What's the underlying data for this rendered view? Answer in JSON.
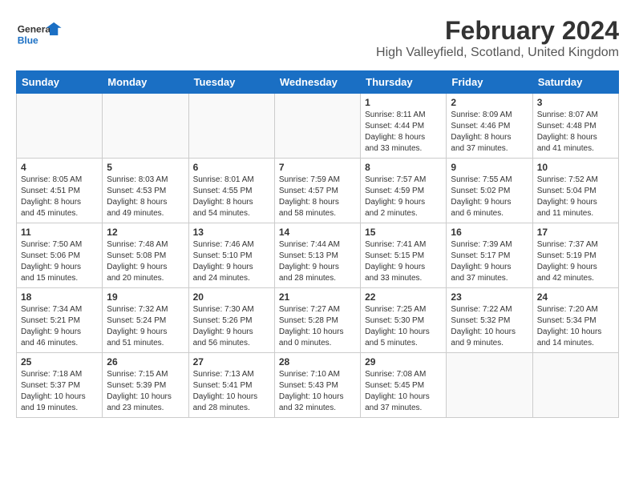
{
  "logo": {
    "line1": "General",
    "line2": "Blue"
  },
  "title": "February 2024",
  "subtitle": "High Valleyfield, Scotland, United Kingdom",
  "days_of_week": [
    "Sunday",
    "Monday",
    "Tuesday",
    "Wednesday",
    "Thursday",
    "Friday",
    "Saturday"
  ],
  "weeks": [
    [
      {
        "day": "",
        "info": ""
      },
      {
        "day": "",
        "info": ""
      },
      {
        "day": "",
        "info": ""
      },
      {
        "day": "",
        "info": ""
      },
      {
        "day": "1",
        "info": "Sunrise: 8:11 AM\nSunset: 4:44 PM\nDaylight: 8 hours\nand 33 minutes."
      },
      {
        "day": "2",
        "info": "Sunrise: 8:09 AM\nSunset: 4:46 PM\nDaylight: 8 hours\nand 37 minutes."
      },
      {
        "day": "3",
        "info": "Sunrise: 8:07 AM\nSunset: 4:48 PM\nDaylight: 8 hours\nand 41 minutes."
      }
    ],
    [
      {
        "day": "4",
        "info": "Sunrise: 8:05 AM\nSunset: 4:51 PM\nDaylight: 8 hours\nand 45 minutes."
      },
      {
        "day": "5",
        "info": "Sunrise: 8:03 AM\nSunset: 4:53 PM\nDaylight: 8 hours\nand 49 minutes."
      },
      {
        "day": "6",
        "info": "Sunrise: 8:01 AM\nSunset: 4:55 PM\nDaylight: 8 hours\nand 54 minutes."
      },
      {
        "day": "7",
        "info": "Sunrise: 7:59 AM\nSunset: 4:57 PM\nDaylight: 8 hours\nand 58 minutes."
      },
      {
        "day": "8",
        "info": "Sunrise: 7:57 AM\nSunset: 4:59 PM\nDaylight: 9 hours\nand 2 minutes."
      },
      {
        "day": "9",
        "info": "Sunrise: 7:55 AM\nSunset: 5:02 PM\nDaylight: 9 hours\nand 6 minutes."
      },
      {
        "day": "10",
        "info": "Sunrise: 7:52 AM\nSunset: 5:04 PM\nDaylight: 9 hours\nand 11 minutes."
      }
    ],
    [
      {
        "day": "11",
        "info": "Sunrise: 7:50 AM\nSunset: 5:06 PM\nDaylight: 9 hours\nand 15 minutes."
      },
      {
        "day": "12",
        "info": "Sunrise: 7:48 AM\nSunset: 5:08 PM\nDaylight: 9 hours\nand 20 minutes."
      },
      {
        "day": "13",
        "info": "Sunrise: 7:46 AM\nSunset: 5:10 PM\nDaylight: 9 hours\nand 24 minutes."
      },
      {
        "day": "14",
        "info": "Sunrise: 7:44 AM\nSunset: 5:13 PM\nDaylight: 9 hours\nand 28 minutes."
      },
      {
        "day": "15",
        "info": "Sunrise: 7:41 AM\nSunset: 5:15 PM\nDaylight: 9 hours\nand 33 minutes."
      },
      {
        "day": "16",
        "info": "Sunrise: 7:39 AM\nSunset: 5:17 PM\nDaylight: 9 hours\nand 37 minutes."
      },
      {
        "day": "17",
        "info": "Sunrise: 7:37 AM\nSunset: 5:19 PM\nDaylight: 9 hours\nand 42 minutes."
      }
    ],
    [
      {
        "day": "18",
        "info": "Sunrise: 7:34 AM\nSunset: 5:21 PM\nDaylight: 9 hours\nand 46 minutes."
      },
      {
        "day": "19",
        "info": "Sunrise: 7:32 AM\nSunset: 5:24 PM\nDaylight: 9 hours\nand 51 minutes."
      },
      {
        "day": "20",
        "info": "Sunrise: 7:30 AM\nSunset: 5:26 PM\nDaylight: 9 hours\nand 56 minutes."
      },
      {
        "day": "21",
        "info": "Sunrise: 7:27 AM\nSunset: 5:28 PM\nDaylight: 10 hours\nand 0 minutes."
      },
      {
        "day": "22",
        "info": "Sunrise: 7:25 AM\nSunset: 5:30 PM\nDaylight: 10 hours\nand 5 minutes."
      },
      {
        "day": "23",
        "info": "Sunrise: 7:22 AM\nSunset: 5:32 PM\nDaylight: 10 hours\nand 9 minutes."
      },
      {
        "day": "24",
        "info": "Sunrise: 7:20 AM\nSunset: 5:34 PM\nDaylight: 10 hours\nand 14 minutes."
      }
    ],
    [
      {
        "day": "25",
        "info": "Sunrise: 7:18 AM\nSunset: 5:37 PM\nDaylight: 10 hours\nand 19 minutes."
      },
      {
        "day": "26",
        "info": "Sunrise: 7:15 AM\nSunset: 5:39 PM\nDaylight: 10 hours\nand 23 minutes."
      },
      {
        "day": "27",
        "info": "Sunrise: 7:13 AM\nSunset: 5:41 PM\nDaylight: 10 hours\nand 28 minutes."
      },
      {
        "day": "28",
        "info": "Sunrise: 7:10 AM\nSunset: 5:43 PM\nDaylight: 10 hours\nand 32 minutes."
      },
      {
        "day": "29",
        "info": "Sunrise: 7:08 AM\nSunset: 5:45 PM\nDaylight: 10 hours\nand 37 minutes."
      },
      {
        "day": "",
        "info": ""
      },
      {
        "day": "",
        "info": ""
      }
    ]
  ]
}
